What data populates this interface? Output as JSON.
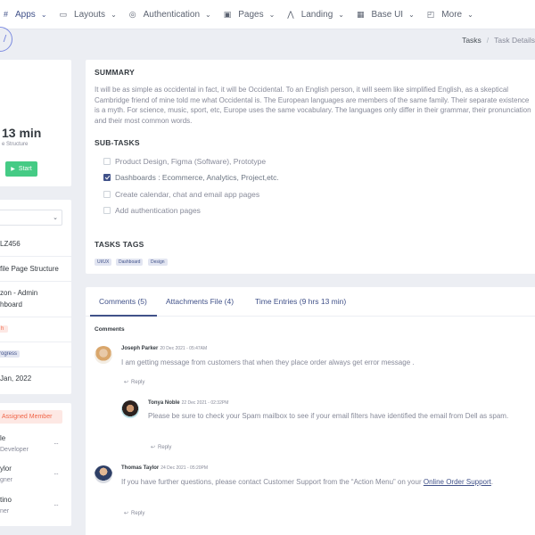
{
  "nav": {
    "items": [
      {
        "label": "Apps",
        "icon": "grid-icon",
        "glyph": "#",
        "active": true
      },
      {
        "label": "Layouts",
        "icon": "layout-icon",
        "glyph": "▭"
      },
      {
        "label": "Authentication",
        "icon": "account-circle-icon",
        "glyph": "◎"
      },
      {
        "label": "Pages",
        "icon": "pages-icon",
        "glyph": "▣"
      },
      {
        "label": "Landing",
        "icon": "rocket-icon",
        "glyph": "⋀"
      },
      {
        "label": "Base UI",
        "icon": "pencil-ruler-icon",
        "glyph": "▦"
      },
      {
        "label": "More",
        "icon": "briefcase-icon",
        "glyph": "◰"
      }
    ],
    "chevron": "⌄"
  },
  "breadcrumb": {
    "parent": "Tasks",
    "separator": "/",
    "current": "Task Details"
  },
  "left": {
    "timer_value": "13 min",
    "timer_subtitle": "e Structure",
    "start_label": "Start",
    "start_glyph": "▶",
    "select_chevron": "⌄",
    "task_no": "LZ456",
    "project_line1": "file Page Structure",
    "client_line1": "zon - Admin",
    "client_line2": "hboard",
    "priority": "h",
    "status": "rogress",
    "due_date": "Jan, 2022",
    "assigned_label": "Assigned Member",
    "members": [
      {
        "name": "le",
        "role": "Developer"
      },
      {
        "name": "ylor",
        "role": "gner"
      },
      {
        "name": "tino",
        "role": "ner"
      }
    ],
    "more_dots": "···"
  },
  "summary": {
    "heading": "SUMMARY",
    "text": "It will be as simple as occidental in fact, it will be Occidental. To an English person, it will seem like simplified English, as a skeptical Cambridge friend of mine told me what Occidental is. The European languages are members of the same family. Their separate existence is a myth. For science, music, sport, etc, Europe uses the same vocabulary. The languages only differ in their grammar, their pronunciation and their most common words.",
    "subtasks_heading": "SUB-TASKS",
    "subtasks": [
      {
        "label": "Product Design, Figma (Software), Prototype",
        "checked": false
      },
      {
        "label": "Dashboards : Ecommerce, Analytics, Project,etc.",
        "checked": true
      },
      {
        "label": "Create calendar, chat and email app pages",
        "checked": false
      },
      {
        "label": "Add authentication pages",
        "checked": false
      }
    ],
    "tags_heading": "TASKS TAGS",
    "tags": [
      "UI/UX",
      "Dashboard",
      "Design"
    ]
  },
  "comments": {
    "tabs": [
      "Comments (5)",
      "Attachments File (4)",
      "Time Entries (9 hrs 13 min)"
    ],
    "section_label": "Comments",
    "reply_label": "Reply",
    "reply_glyph": "↩",
    "items": [
      {
        "name": "Joseph Parker",
        "date": "20 Dec 2021 - 05:47AM",
        "text": "I am getting message from customers that when they place order always get error message ."
      },
      {
        "name": "Tonya Noble",
        "date": "22 Dec 2021 - 02:32PM",
        "text": "Please be sure to check your Spam mailbox to see if your email filters have identified the email from Dell as spam."
      },
      {
        "name": "Thomas Taylor",
        "date": "24 Dec 2021 - 05:20PM",
        "text": "If you have further questions, please contact Customer Support from the “Action Menu” on your ",
        "link": "Online Order Support",
        "after_link": "."
      }
    ]
  }
}
